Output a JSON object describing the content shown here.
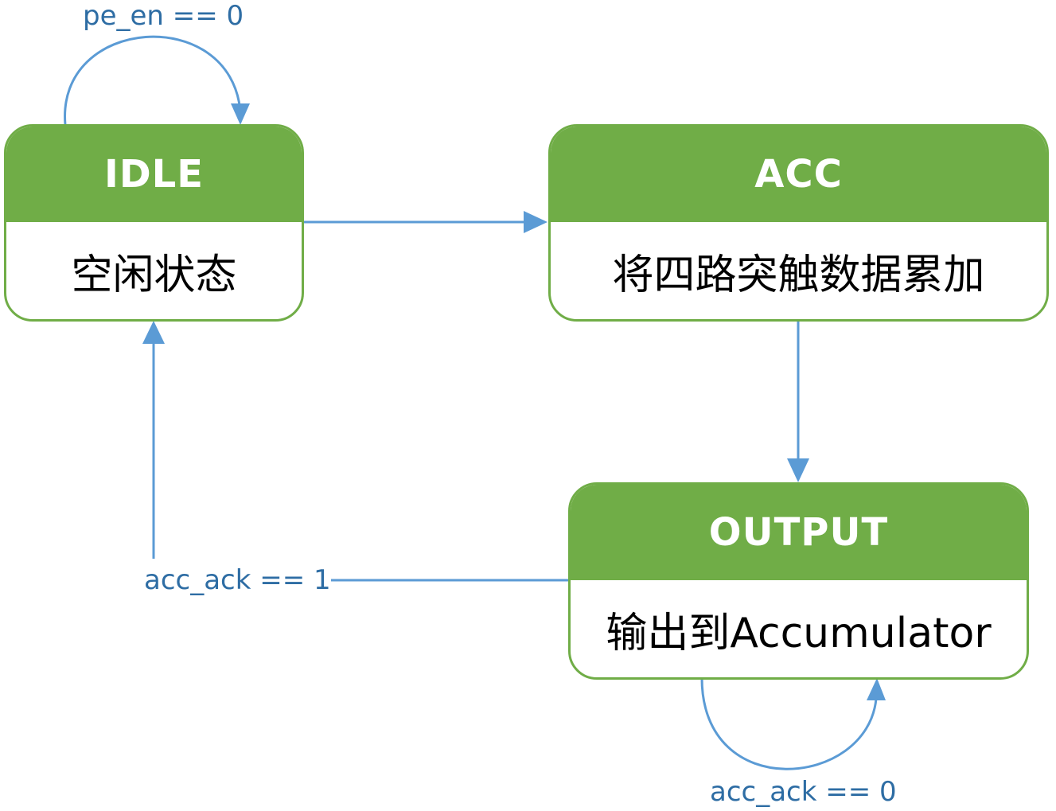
{
  "colors": {
    "state_fill": "#70ad47",
    "arrow": "#5b9bd5",
    "label_text": "#2e6da4"
  },
  "states": {
    "idle": {
      "title": "IDLE",
      "description": "空闲状态"
    },
    "acc": {
      "title": "ACC",
      "description": "将四路突触数据累加"
    },
    "output": {
      "title": "OUTPUT",
      "description": "输出到Accumulator"
    }
  },
  "transitions": {
    "idle_self": {
      "condition": "pe_en == 0"
    },
    "output_idle": {
      "condition": "acc_ack == 1"
    },
    "output_self": {
      "condition": "acc_ack == 0"
    }
  }
}
